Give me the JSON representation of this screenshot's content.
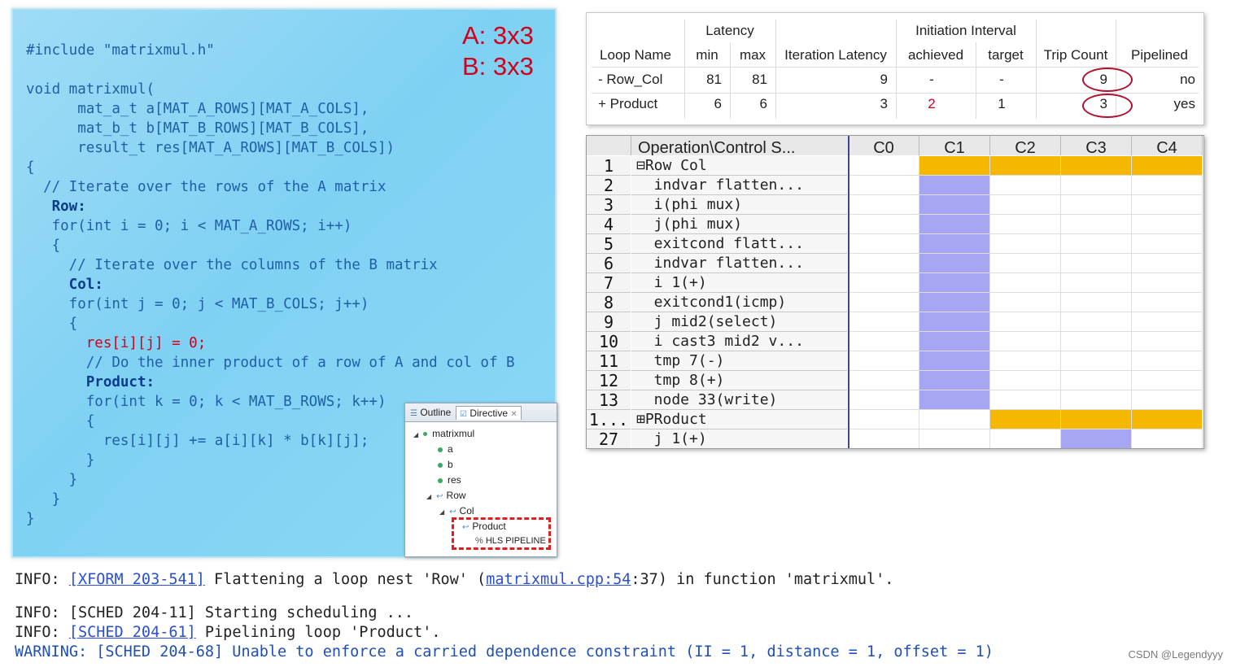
{
  "code": {
    "dims": [
      "A: 3x3",
      "B: 3x3"
    ],
    "lines": [
      "#include \"matrixmul.h\"",
      "void matrixmul(",
      "      mat_a_t a[MAT_A_ROWS][MAT_A_COLS],",
      "      mat_b_t b[MAT_B_ROWS][MAT_B_COLS],",
      "      result_t res[MAT_A_ROWS][MAT_B_COLS])",
      "{",
      "  // Iterate over the rows of the A matrix",
      "   Row:",
      "   for(int i = 0; i < MAT_A_ROWS; i++)",
      "   {",
      "     // Iterate over the columns of the B matrix",
      "     Col:",
      "     for(int j = 0; j < MAT_B_COLS; j++)",
      "     {",
      "       res[i][j] = 0;",
      "       // Do the inner product of a row of A and col of B",
      "       Product:",
      "       for(int k = 0; k < MAT_B_ROWS; k++)",
      "       {",
      "         res[i][j] += a[i][k] * b[k][j];",
      "       }",
      "     }",
      "   }",
      "}"
    ]
  },
  "outline": {
    "tabs": [
      "Outline",
      "Directive"
    ],
    "items": [
      "matrixmul",
      "a",
      "b",
      "res",
      "Row",
      "Col",
      "Product",
      "HLS PIPELINE"
    ]
  },
  "loop_table": {
    "group_headers": [
      "Latency",
      "Initiation Interval"
    ],
    "columns": [
      "Loop Name",
      "min",
      "max",
      "Iteration Latency",
      "achieved",
      "target",
      "Trip Count",
      "Pipelined"
    ],
    "rows": [
      [
        "- Row_Col",
        "81",
        "81",
        "9",
        "-",
        "-",
        "9",
        "no"
      ],
      [
        "+ Product",
        "6",
        "6",
        "3",
        "2",
        "1",
        "3",
        "yes"
      ]
    ]
  },
  "schedule": {
    "columns": [
      "Operation\\Control S...",
      "C0",
      "C1",
      "C2",
      "C3",
      "C4"
    ],
    "rows": [
      {
        "num": "1",
        "op": "⊟Row Col",
        "fill": "yellow-all"
      },
      {
        "num": "2",
        "op": "  indvar flatten...",
        "fill": "blue-c1"
      },
      {
        "num": "3",
        "op": "  i(phi mux)",
        "fill": "blue-c1"
      },
      {
        "num": "4",
        "op": "  j(phi mux)",
        "fill": "blue-c1"
      },
      {
        "num": "5",
        "op": "  exitcond flatt...",
        "fill": "blue-c1"
      },
      {
        "num": "6",
        "op": "  indvar flatten...",
        "fill": "blue-c1"
      },
      {
        "num": "7",
        "op": "  i 1(+)",
        "fill": "blue-c1"
      },
      {
        "num": "8",
        "op": "  exitcond1(icmp)",
        "fill": "blue-c1"
      },
      {
        "num": "9",
        "op": "  j mid2(select)",
        "fill": "blue-c1"
      },
      {
        "num": "10",
        "op": "  i cast3 mid2 v...",
        "fill": "blue-c1"
      },
      {
        "num": "11",
        "op": "  tmp 7(-)",
        "fill": "blue-c1"
      },
      {
        "num": "12",
        "op": "  tmp 8(+)",
        "fill": "blue-c1"
      },
      {
        "num": "13",
        "op": "  node 33(write)",
        "fill": "blue-c1"
      },
      {
        "num": "1...",
        "op": "⊞PRoduct",
        "fill": "yellow-c2"
      },
      {
        "num": "27",
        "op": "  j 1(+)",
        "fill": "blue-c3"
      }
    ]
  },
  "console": {
    "line1_prefix": "INFO: ",
    "line1_link": "[XFORM 203-541]",
    "line1_mid": " Flattening a loop nest 'Row' (",
    "line1_link2": "matrixmul.cpp:54",
    "line1_suffix": ":37) in function 'matrixmul'.",
    "line2": "INFO: [SCHED 204-11] Starting scheduling ...",
    "line3_prefix": "INFO: ",
    "line3_link": "[SCHED 204-61]",
    "line3_suffix": " Pipelining loop 'Product'.",
    "line4": "WARNING: [SCHED 204-68] Unable to enforce a carried dependence constraint (II = 1, distance = 1, offset = 1)"
  },
  "watermark": "CSDN @Legendyyy",
  "colors": {
    "yellow": "#f5b700",
    "blue": "#a6a6f2",
    "accent_red": "#d0021b"
  }
}
